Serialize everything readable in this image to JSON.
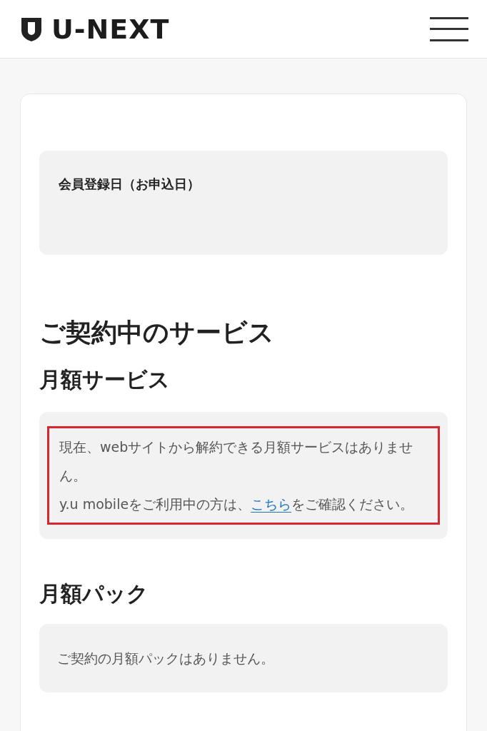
{
  "header": {
    "logo": "U-NEXT"
  },
  "registration": {
    "label": "会員登録日（お申込日）"
  },
  "section_title": "ご契約中のサービス",
  "monthly_service": {
    "title": "月額サービス",
    "highlighted": true,
    "message": "現在、webサイトから解約できる月額サービスはありません。",
    "note_before": "y.u mobileをご利用中の方は、",
    "note_link": "こちら",
    "note_after": "をご確認ください。"
  },
  "monthly_pack": {
    "title": "月額パック",
    "message": "ご契約の月額パックはありません。"
  }
}
